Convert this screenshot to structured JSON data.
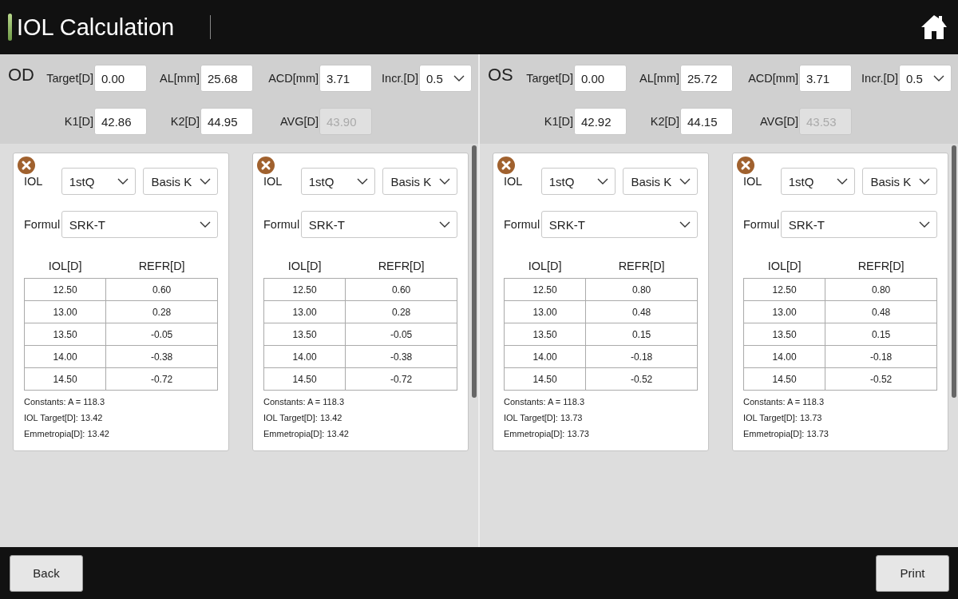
{
  "header": {
    "title": "IOL Calculation"
  },
  "eyes": [
    {
      "label": "OD",
      "fields": [
        {
          "label": "Target[D]",
          "value": "0.00",
          "kind": "input",
          "disabled": false
        },
        {
          "label": "AL[mm]",
          "value": "25.68",
          "kind": "input",
          "disabled": false
        },
        {
          "label": "ACD[mm]",
          "value": "3.71",
          "kind": "input",
          "disabled": false
        },
        {
          "label": "Incr.[D]",
          "value": "0.5",
          "kind": "select",
          "disabled": false
        },
        {
          "label": "K1[D]",
          "value": "42.86",
          "kind": "input",
          "disabled": false
        },
        {
          "label": "K2[D]",
          "value": "44.95",
          "kind": "input",
          "disabled": false
        },
        {
          "label": "AVG[D]",
          "value": "43.90",
          "kind": "input",
          "disabled": true
        }
      ],
      "cards": [
        {
          "iol_label": "IOL",
          "lens": "1stQ",
          "k_mode": "Basis K",
          "formula_label": "Formul",
          "formula": "SRK-T",
          "columns": [
            "IOL[D]",
            "REFR[D]"
          ],
          "rows": [
            [
              "12.50",
              "0.60"
            ],
            [
              "13.00",
              "0.28"
            ],
            [
              "13.50",
              "-0.05"
            ],
            [
              "14.00",
              "-0.38"
            ],
            [
              "14.50",
              "-0.72"
            ]
          ],
          "notes": [
            "Constants: A = 118.3",
            "IOL Target[D]: 13.42",
            "Emmetropia[D]: 13.42"
          ]
        },
        {
          "iol_label": "IOL",
          "lens": "1stQ",
          "k_mode": "Basis K",
          "formula_label": "Formul",
          "formula": "SRK-T",
          "columns": [
            "IOL[D]",
            "REFR[D]"
          ],
          "rows": [
            [
              "12.50",
              "0.60"
            ],
            [
              "13.00",
              "0.28"
            ],
            [
              "13.50",
              "-0.05"
            ],
            [
              "14.00",
              "-0.38"
            ],
            [
              "14.50",
              "-0.72"
            ]
          ],
          "notes": [
            "Constants: A = 118.3",
            "IOL Target[D]: 13.42",
            "Emmetropia[D]: 13.42"
          ]
        }
      ]
    },
    {
      "label": "OS",
      "fields": [
        {
          "label": "Target[D]",
          "value": "0.00",
          "kind": "input",
          "disabled": false
        },
        {
          "label": "AL[mm]",
          "value": "25.72",
          "kind": "input",
          "disabled": false
        },
        {
          "label": "ACD[mm]",
          "value": "3.71",
          "kind": "input",
          "disabled": false
        },
        {
          "label": "Incr.[D]",
          "value": "0.5",
          "kind": "select",
          "disabled": false
        },
        {
          "label": "K1[D]",
          "value": "42.92",
          "kind": "input",
          "disabled": false
        },
        {
          "label": "K2[D]",
          "value": "44.15",
          "kind": "input",
          "disabled": false
        },
        {
          "label": "AVG[D]",
          "value": "43.53",
          "kind": "input",
          "disabled": true
        }
      ],
      "cards": [
        {
          "iol_label": "IOL",
          "lens": "1stQ",
          "k_mode": "Basis K",
          "formula_label": "Formul",
          "formula": "SRK-T",
          "columns": [
            "IOL[D]",
            "REFR[D]"
          ],
          "rows": [
            [
              "12.50",
              "0.80"
            ],
            [
              "13.00",
              "0.48"
            ],
            [
              "13.50",
              "0.15"
            ],
            [
              "14.00",
              "-0.18"
            ],
            [
              "14.50",
              "-0.52"
            ]
          ],
          "notes": [
            "Constants: A = 118.3",
            "IOL Target[D]: 13.73",
            "Emmetropia[D]: 13.73"
          ]
        },
        {
          "iol_label": "IOL",
          "lens": "1stQ",
          "k_mode": "Basis K",
          "formula_label": "Formul",
          "formula": "SRK-T",
          "columns": [
            "IOL[D]",
            "REFR[D]"
          ],
          "rows": [
            [
              "12.50",
              "0.80"
            ],
            [
              "13.00",
              "0.48"
            ],
            [
              "13.50",
              "0.15"
            ],
            [
              "14.00",
              "-0.18"
            ],
            [
              "14.50",
              "-0.52"
            ]
          ],
          "notes": [
            "Constants: A = 118.3",
            "IOL Target[D]: 13.73",
            "Emmetropia[D]: 13.73"
          ]
        }
      ]
    }
  ],
  "footer": {
    "buttons": [
      "Back",
      "Print"
    ]
  }
}
